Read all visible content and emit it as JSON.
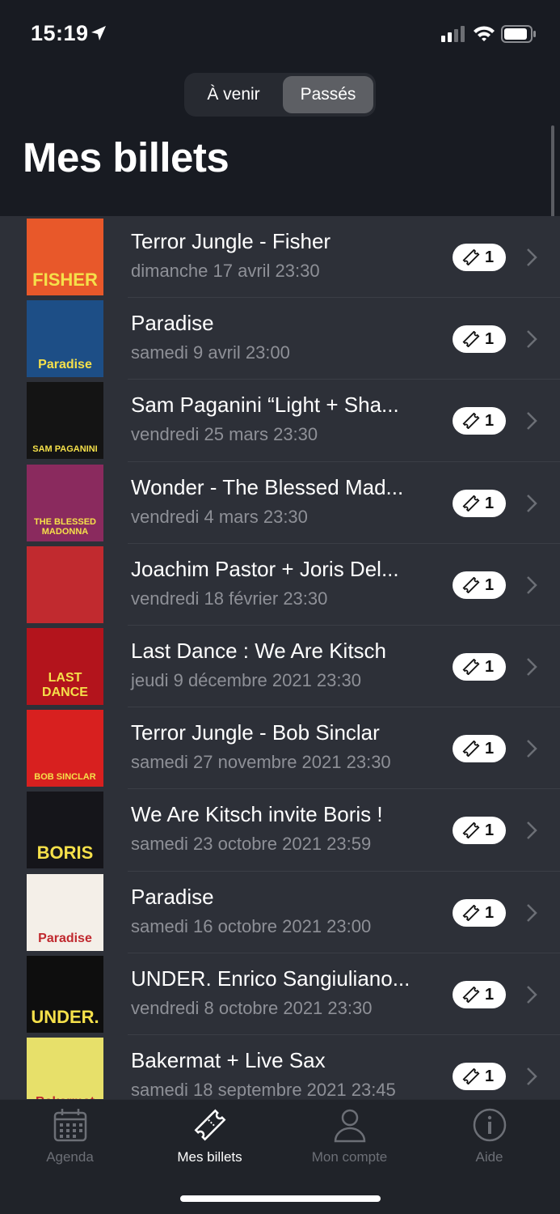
{
  "status_bar": {
    "time": "15:19"
  },
  "segmented": {
    "upcoming": "À venir",
    "past": "Passés",
    "selected": "past"
  },
  "header": {
    "title": "Mes billets"
  },
  "tickets": [
    {
      "title": "Terror Jungle - Fisher",
      "date": "dimanche 17 avril 23:30",
      "count": "1",
      "poster_text": "FISHER",
      "poster_bg": "#e8582a"
    },
    {
      "title": "Paradise",
      "date": "samedi 9 avril 23:00",
      "count": "1",
      "poster_text": "Paradise",
      "poster_bg": "#1d4e86"
    },
    {
      "title": "Sam Paganini “Light + Sha...",
      "date": "vendredi 25 mars 23:30",
      "count": "1",
      "poster_text": "SAM PAGANINI",
      "poster_bg": "#141414"
    },
    {
      "title": "Wonder - The Blessed Mad...",
      "date": "vendredi 4 mars 23:30",
      "count": "1",
      "poster_text": "THE BLESSED MADONNA",
      "poster_bg": "#8a2a5e"
    },
    {
      "title": "Joachim Pastor + Joris Del...",
      "date": "vendredi 18 février 23:30",
      "count": "1",
      "poster_text": "",
      "poster_bg": "#c12a2f"
    },
    {
      "title": "Last Dance : We Are Kitsch",
      "date": "jeudi 9 décembre 2021 23:30",
      "count": "1",
      "poster_text": "LAST DANCE",
      "poster_bg": "#b3141c"
    },
    {
      "title": "Terror Jungle - Bob Sinclar",
      "date": "samedi 27 novembre 2021 23:30",
      "count": "1",
      "poster_text": "BOB SINCLAR",
      "poster_bg": "#d8201f"
    },
    {
      "title": "We Are Kitsch invite Boris !",
      "date": "samedi 23 octobre 2021 23:59",
      "count": "1",
      "poster_text": "BORIS",
      "poster_bg": "#15151a"
    },
    {
      "title": "Paradise",
      "date": "samedi 16 octobre 2021 23:00",
      "count": "1",
      "poster_text": "Paradise",
      "poster_bg": "#f4efe8"
    },
    {
      "title": "UNDER. Enrico Sangiuliano...",
      "date": "vendredi 8 octobre 2021 23:30",
      "count": "1",
      "poster_text": "UNDER.",
      "poster_bg": "#0e0e0e"
    },
    {
      "title": "Bakermat + Live Sax",
      "date": "samedi 18 septembre 2021 23:45",
      "count": "1",
      "poster_text": "Bakermat",
      "poster_bg": "#e7e06a"
    }
  ],
  "tabbar": {
    "agenda": "Agenda",
    "tickets": "Mes billets",
    "account": "Mon compte",
    "help": "Aide",
    "active": "tickets"
  },
  "colors": {
    "background": "#181b22",
    "list_bg": "#2d3038",
    "active_tab": "#ffffff",
    "inactive_tab": "#6c6f76"
  }
}
